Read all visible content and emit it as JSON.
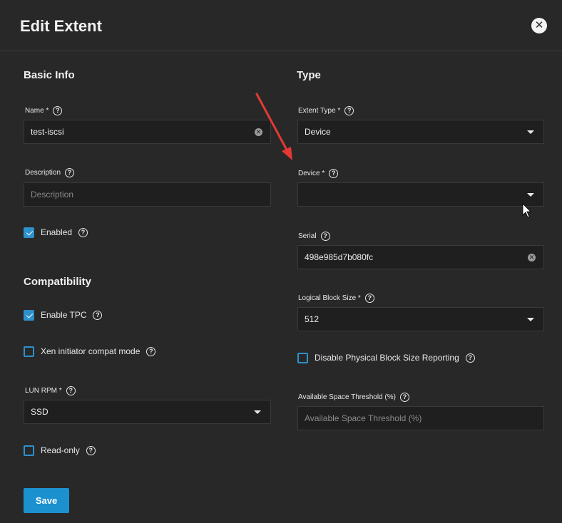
{
  "dialog": {
    "title": "Edit Extent",
    "close_label": "✕"
  },
  "basic_info": {
    "title": "Basic Info",
    "name": {
      "label": "Name *",
      "value": "test-iscsi"
    },
    "description": {
      "label": "Description",
      "placeholder": "Description"
    },
    "enabled": {
      "label": "Enabled",
      "checked": true
    }
  },
  "compatibility": {
    "title": "Compatibility",
    "enable_tpc": {
      "label": "Enable TPC",
      "checked": true
    },
    "xen_compat": {
      "label": "Xen initiator compat mode",
      "checked": false
    },
    "lun_rpm": {
      "label": "LUN RPM *",
      "value": "SSD"
    },
    "read_only": {
      "label": "Read-only",
      "checked": false
    }
  },
  "type": {
    "title": "Type",
    "extent_type": {
      "label": "Extent Type *",
      "value": "Device"
    },
    "device": {
      "label": "Device *",
      "value": ""
    },
    "serial": {
      "label": "Serial",
      "value": "498e985d7b080fc"
    },
    "logical_block_size": {
      "label": "Logical Block Size *",
      "value": "512"
    },
    "disable_pbs": {
      "label": "Disable Physical Block Size Reporting",
      "checked": false
    },
    "threshold": {
      "label": "Available Space Threshold (%)",
      "placeholder": "Available Space Threshold (%)"
    }
  },
  "actions": {
    "save_label": "Save"
  },
  "colors": {
    "accent": "#1b91cf",
    "checkbox": "#2e91cc",
    "annotation_arrow": "#e53935",
    "background": "#282828"
  },
  "icons": {
    "help": "help-circle-icon",
    "clear": "clear-circle-icon",
    "dropdown": "caret-down-icon",
    "close": "close-icon"
  }
}
